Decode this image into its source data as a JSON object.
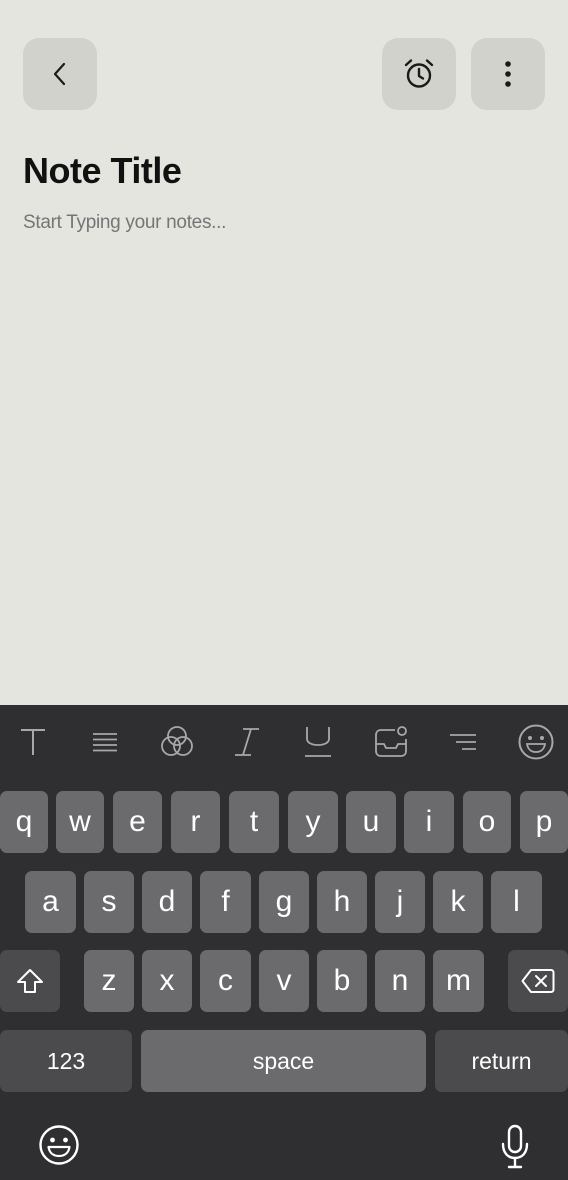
{
  "note": {
    "title": "Note Title",
    "body_placeholder": "Start Typing your notes..."
  },
  "header": {
    "icons": [
      "chevron-left-icon",
      "alarm-clock-icon",
      "more-vertical-icon"
    ]
  },
  "toolbar": {
    "icons": [
      "text-icon",
      "align-icon",
      "colors-icon",
      "italic-icon",
      "underline-icon",
      "inbox-notification-icon",
      "filter-lines-icon",
      "emoji-icon"
    ]
  },
  "keyboard": {
    "row1": [
      "q",
      "w",
      "e",
      "r",
      "t",
      "y",
      "u",
      "i",
      "o",
      "p"
    ],
    "row2": [
      "a",
      "s",
      "d",
      "f",
      "g",
      "h",
      "j",
      "k",
      "l"
    ],
    "row3": [
      "z",
      "x",
      "c",
      "v",
      "b",
      "n",
      "m"
    ],
    "numbers_label": "123",
    "space_label": "space",
    "return_label": "return",
    "bottom_icons": [
      "emoji-icon",
      "microphone-icon"
    ]
  },
  "colors": {
    "note_background": "#e5e5e0",
    "button_background": "#d2d2cd",
    "keyboard_background": "#2f2f31",
    "key_light": "#6b6b6d",
    "key_dark": "#4b4b4d"
  }
}
